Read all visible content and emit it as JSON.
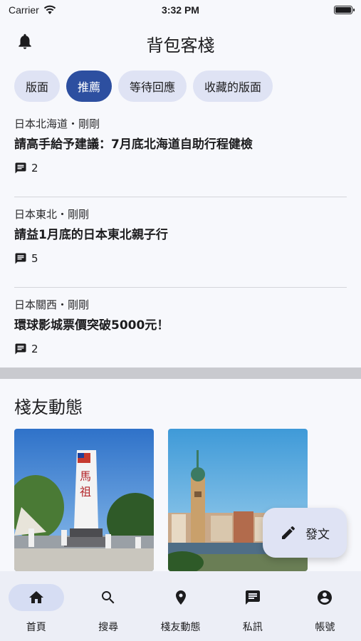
{
  "status_bar": {
    "carrier": "Carrier",
    "time": "3:32 PM",
    "battery_level": 1.0
  },
  "app_bar": {
    "title": "背包客棧"
  },
  "chips": [
    {
      "label": "版面",
      "active": false
    },
    {
      "label": "推薦",
      "active": true
    },
    {
      "label": "等待回應",
      "active": false
    },
    {
      "label": "收藏的版面",
      "active": false
    }
  ],
  "posts": [
    {
      "meta": "日本北海道・剛剛",
      "title": "請高手給予建議：7月底北海道自助行程健檢",
      "comments": "2"
    },
    {
      "meta": "日本東北・剛剛",
      "title": "請益1月底的日本東北親子行",
      "comments": "5"
    },
    {
      "meta": "日本關西・剛剛",
      "title": "環球影城票價突破5000元！",
      "comments": "2"
    }
  ],
  "friends": {
    "title": "棧友動態"
  },
  "fab": {
    "label": "發文"
  },
  "nav": [
    {
      "label": "首頁",
      "icon": "home-icon",
      "active": true
    },
    {
      "label": "搜尋",
      "icon": "search-icon",
      "active": false
    },
    {
      "label": "棧友動態",
      "icon": "location-pin-icon",
      "active": false
    },
    {
      "label": "私訊",
      "icon": "message-icon",
      "active": false
    },
    {
      "label": "帳號",
      "icon": "account-icon",
      "active": false
    }
  ],
  "colors": {
    "accent": "#2d4fa0",
    "chip_bg": "#dfe3f4",
    "background": "#f7f8fc"
  }
}
